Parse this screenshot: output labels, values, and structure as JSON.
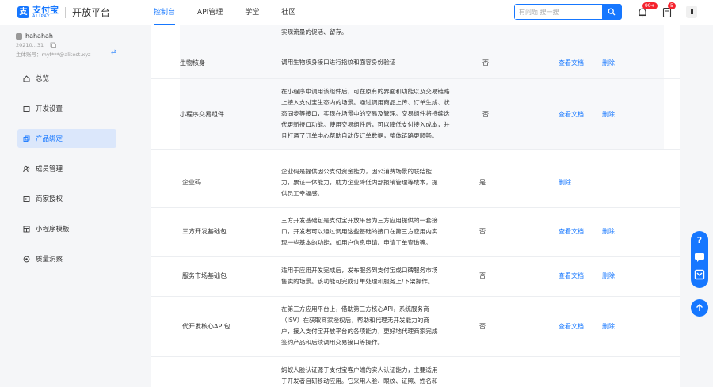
{
  "header": {
    "logo_cn": "支付宝",
    "logo_en": "ALIPAY",
    "platform": "开放平台",
    "tabs": [
      {
        "label": "控制台",
        "active": true
      },
      {
        "label": "API管理",
        "active": false
      },
      {
        "label": "学堂",
        "active": false
      },
      {
        "label": "社区",
        "active": false
      }
    ],
    "search_placeholder": "有问题 搜一搜",
    "notification_badge": "99+",
    "message_badge": "5"
  },
  "sidebar": {
    "user_name": "hahahah",
    "user_id": "20210...31",
    "account_label": "主体账号：",
    "account_value": "myf***@alitest.xyz",
    "menu": [
      {
        "label": "总览",
        "icon": "home-icon",
        "active": false
      },
      {
        "label": "开发设置",
        "icon": "dev-settings-icon",
        "active": false
      },
      {
        "label": "产品绑定",
        "icon": "product-bind-icon",
        "active": true
      },
      {
        "label": "成员管理",
        "icon": "members-icon",
        "active": false
      },
      {
        "label": "商家授权",
        "icon": "merchant-auth-icon",
        "active": false
      },
      {
        "label": "小程序模板",
        "icon": "template-icon",
        "active": false
      },
      {
        "label": "质量洞察",
        "icon": "quality-icon",
        "active": false
      }
    ]
  },
  "table": {
    "link_doc": "查看文档",
    "link_delete": "删除",
    "rows": [
      {
        "name": "",
        "desc": [
          "实现流量的促活、留存。"
        ],
        "flag": ""
      },
      {
        "name": "生物核身",
        "desc": [
          "调用生物核身接口进行指纹和面容身份验证"
        ],
        "flag": "否"
      },
      {
        "name": "小程序交易组件",
        "desc": [
          "在小程序中调用该组件后，可在原有的界面和功能以及交易链路",
          "上接入支付宝生态内的场景。通过调用商品上传、订单生成、状",
          "态同步等接口，实现在场景中的交易及管理。交易组件将持续迭",
          "代更新接口功能。使用交易组件后，可以降低支付接入成本，并",
          "且打通了订单中心帮助自动传订单数据，整体链路更顺畅。"
        ],
        "flag": "否"
      },
      {
        "name": "企业码",
        "desc": [
          "企业码是提供因公支付资金能力，因公消费场景的联结能",
          "力，票证一体能力，助力企业降低内部报销管理等成本，提",
          "供员工幸福感。"
        ],
        "flag": "是"
      },
      {
        "name": "三方开发基础包",
        "desc": [
          "三方开发基础包是支付宝开放平台为三方应用提供的一套接",
          "口，开发者可以通过调用这些基础的接口在第三方应用内实",
          "现一些基本的功能，如用户信息申请、申请工单查询等。"
        ],
        "flag": "否"
      },
      {
        "name": "服务市场基础包",
        "desc": [
          "适用于应用开发完成后，发布服务到支付宝或口碑服务市场",
          "售卖的场景。该功能可完成订单处理和服务上/下架操作。"
        ],
        "flag": "否"
      },
      {
        "name": "代开发核心API包",
        "desc": [
          "在第三方应用平台上，借助第三方核心API，系统服务商",
          "（ISV）在获取商家授权后，帮助和代理无开发能力的商",
          "户，接入支付宝开放平台的各项能力，更好地代理商家完成",
          "签约产品和后续调用交易接口等操作。"
        ],
        "flag": "否"
      },
      {
        "name": "",
        "desc": [
          "蚂蚁人脸认证源于支付宝客户端的实人认证能力，主要适用",
          "于开发者自研移动应用。它采用人脸、眼纹、证照、姓名和"
        ],
        "flag": ""
      }
    ]
  },
  "colors": {
    "accent": "#1677ff",
    "active_bg": "#dbe7fb",
    "badge": "#f5222d"
  }
}
